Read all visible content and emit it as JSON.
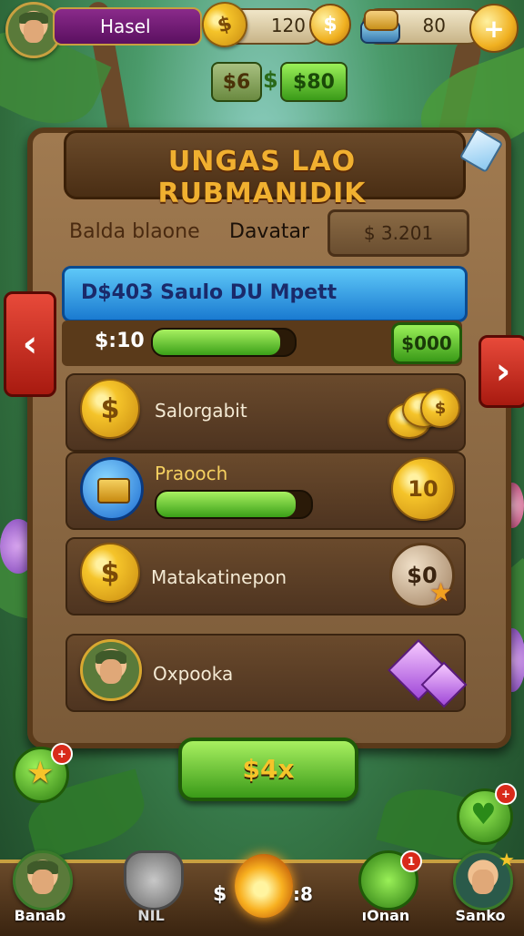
{
  "header": {
    "player_name": "Hasel",
    "coins": "120",
    "gems": "80",
    "plus_symbol": "+",
    "coin_symbol": "$"
  },
  "money_badges": {
    "left": "$6",
    "separator": "$",
    "right": "$80"
  },
  "panel": {
    "title": "UNGAS LAO RUBMANIDIK",
    "balance_label": "Balda blaone",
    "balance_label_2": "Davatar",
    "balance_value": "$ 3.201",
    "banner_text": "D$403 Saulo DU Mpett",
    "progress_label": "$:10",
    "progress_fraction": 0.9,
    "progress_button": "$000"
  },
  "rows": [
    {
      "label": "Salorgabit",
      "coin_symbol": "$"
    },
    {
      "label": "Praooch",
      "reward": "10",
      "progress_fraction": 0.9
    },
    {
      "label": "Matakatinepon",
      "coin_symbol": "$",
      "reward": "$0"
    },
    {
      "label": "Oxpooka"
    }
  ],
  "main_button": "$4x",
  "nav": [
    {
      "label": "Banab"
    },
    {
      "label": "NIL"
    },
    {
      "label": "$"
    },
    {
      "label": ":8"
    },
    {
      "label": "ıOnan"
    },
    {
      "label": "Sanko"
    }
  ],
  "notifications": {
    "left": "+",
    "right": "+",
    "nav_left": "1"
  },
  "colors": {
    "accent_gold": "#f5c42a",
    "panel_brown": "#7a5a38",
    "green": "#3a9a18",
    "blue": "#1a7ad0",
    "red": "#a81a10"
  }
}
